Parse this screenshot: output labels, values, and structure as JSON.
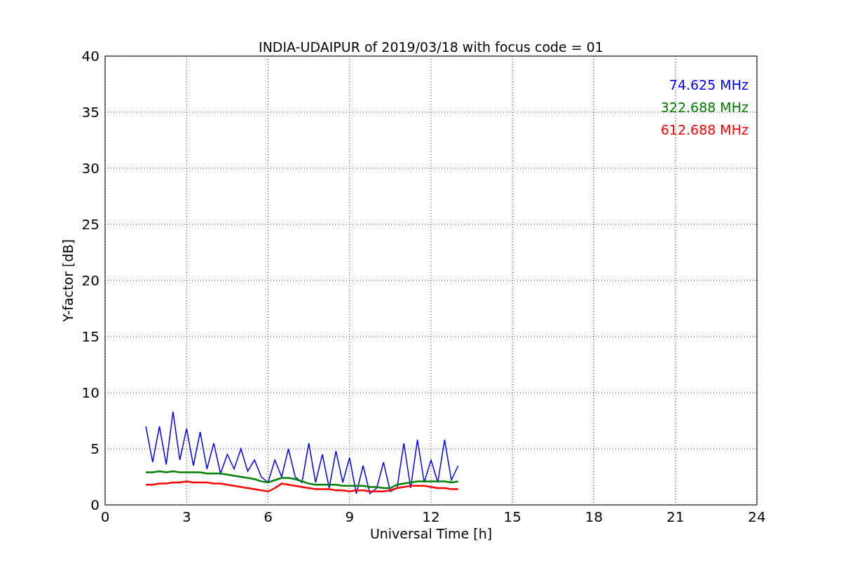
{
  "chart_data": {
    "type": "line",
    "title": "INDIA-UDAIPUR of 2019/03/18 with focus code = 01",
    "xlabel": "Universal Time [h]",
    "ylabel": "Y-factor [dB]",
    "x": [
      1.5,
      1.75,
      2,
      2.25,
      2.5,
      2.75,
      3,
      3.25,
      3.5,
      3.75,
      4,
      4.25,
      4.5,
      4.75,
      5,
      5.25,
      5.5,
      5.75,
      6,
      6.25,
      6.5,
      6.75,
      7,
      7.25,
      7.5,
      7.75,
      8,
      8.25,
      8.5,
      8.75,
      9,
      9.25,
      9.5,
      9.75,
      10,
      10.25,
      10.5,
      10.75,
      11,
      11.25,
      11.5,
      11.75,
      12,
      12.25,
      12.5,
      12.75,
      13
    ],
    "series": [
      {
        "name": "74.625 MHz",
        "color": "#0000ff",
        "values": [
          7.0,
          3.8,
          7.0,
          3.6,
          8.3,
          4.0,
          6.8,
          3.5,
          6.5,
          3.2,
          5.5,
          2.8,
          4.5,
          3.2,
          5.0,
          3.0,
          4.0,
          2.5,
          2.0,
          4.0,
          2.5,
          5.0,
          2.5,
          2.0,
          5.5,
          2.0,
          4.5,
          1.5,
          4.8,
          2.0,
          4.2,
          1.0,
          3.5,
          1.0,
          1.5,
          3.8,
          1.2,
          1.5,
          5.5,
          1.5,
          5.8,
          2.0,
          4.0,
          2.0,
          5.8,
          2.2,
          3.5
        ]
      },
      {
        "name": "322.688 MHz",
        "color": "#008000",
        "values": [
          2.9,
          2.9,
          3.0,
          2.9,
          3.0,
          2.9,
          2.9,
          2.9,
          2.9,
          2.8,
          2.8,
          2.8,
          2.7,
          2.6,
          2.5,
          2.4,
          2.3,
          2.1,
          2.0,
          2.2,
          2.4,
          2.4,
          2.3,
          2.1,
          1.9,
          1.8,
          1.8,
          1.8,
          1.8,
          1.7,
          1.7,
          1.7,
          1.7,
          1.6,
          1.6,
          1.5,
          1.5,
          1.8,
          1.9,
          2.0,
          2.1,
          2.1,
          2.1,
          2.1,
          2.1,
          2.0,
          2.1
        ]
      },
      {
        "name": "612.688 MHz",
        "color": "#ff0000",
        "values": [
          1.8,
          1.8,
          1.9,
          1.9,
          2.0,
          2.0,
          2.1,
          2.0,
          2.0,
          2.0,
          1.9,
          1.9,
          1.8,
          1.7,
          1.6,
          1.5,
          1.4,
          1.3,
          1.2,
          1.5,
          1.9,
          1.8,
          1.7,
          1.6,
          1.5,
          1.4,
          1.4,
          1.4,
          1.3,
          1.3,
          1.2,
          1.3,
          1.3,
          1.2,
          1.2,
          1.2,
          1.3,
          1.5,
          1.6,
          1.7,
          1.7,
          1.7,
          1.6,
          1.5,
          1.5,
          1.4,
          1.4
        ]
      }
    ],
    "xlim": [
      0,
      24
    ],
    "ylim": [
      0,
      40
    ],
    "xticks": [
      0,
      3,
      6,
      9,
      12,
      15,
      18,
      21,
      24
    ],
    "yticks": [
      0,
      5,
      10,
      15,
      20,
      25,
      30,
      35,
      40
    ],
    "grid": true
  }
}
